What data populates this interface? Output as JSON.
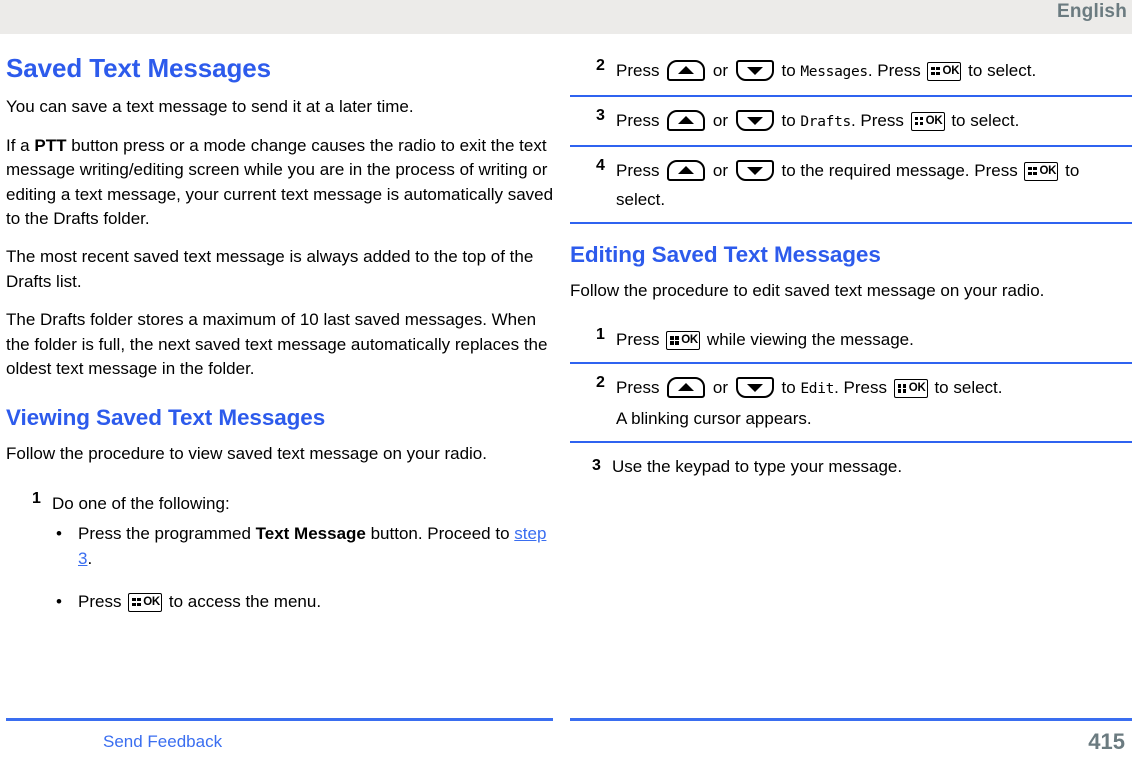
{
  "header": {
    "language": "English"
  },
  "left_column": {
    "section_title": "Saved Text Messages",
    "paragraphs": [
      "You can save a text message to send it at a later time.",
      "If a PTT button press or a mode change causes the radio to exit the text message writing/editing screen while you are in the process of writing or editing a text message, your current text message is automatically saved to the Drafts folder.",
      "The most recent saved text message is always added to the top of the Drafts list.",
      "The Drafts folder stores a maximum of 10 last saved messages. When the folder is full, the next saved text message automatically replaces the oldest text message in the folder."
    ],
    "p2_parts": {
      "before": "If a ",
      "bold": "PTT",
      "after": " button press or a mode change causes the radio to exit the text message writing/editing screen while you are in the process of writing or editing a text message, your current text message is automatically saved to the Drafts folder."
    },
    "subsection_title": "Viewing Saved Text Messages",
    "subsection_intro": "Follow the procedure to view saved text message on your radio.",
    "steps": [
      {
        "num": "1",
        "text": "Do one of the following:",
        "bullets": [
          {
            "marker": "•",
            "before": "Press the programmed ",
            "bold": "Text Message",
            "after": " button. Proceed to ",
            "xref": "step 3",
            "tail": "."
          },
          {
            "marker": "•",
            "before": "Press ",
            "icon": "ok-key-icon",
            "after": " to access the menu."
          }
        ]
      }
    ]
  },
  "right_column": {
    "steps_continued": [
      {
        "num": "2",
        "seg1": "Press ",
        "icon_up": "nav-up-key-icon",
        "seg2": " or ",
        "icon_down": "nav-down-key-icon",
        "seg3": " to ",
        "mono": "Messages",
        "seg4": ". Press ",
        "icon_ok": "ok-key-icon",
        "seg5": " to select."
      },
      {
        "num": "3",
        "seg1": "Press ",
        "icon_up": "nav-up-key-icon",
        "seg2": " or ",
        "icon_down": "nav-down-key-icon",
        "seg3": " to ",
        "mono": "Drafts",
        "seg4": ". Press ",
        "icon_ok": "ok-key-icon",
        "seg5": " to select."
      },
      {
        "num": "4",
        "seg1": "Press ",
        "icon_up": "nav-up-key-icon",
        "seg2": " or ",
        "icon_down": "nav-down-key-icon",
        "seg3": " to the required message. Press ",
        "icon_ok": "ok-key-icon",
        "seg5": " to select."
      }
    ],
    "subsection_title": "Editing Saved Text Messages",
    "subsection_intro": "Follow the procedure to edit saved text message on your radio.",
    "edit_steps": [
      {
        "num": "1",
        "seg1": "Press ",
        "icon_ok": "ok-key-icon",
        "seg5": " while viewing the message."
      },
      {
        "num": "2",
        "seg1": "Press ",
        "icon_up": "nav-up-key-icon",
        "seg2": " or ",
        "icon_down": "nav-down-key-icon",
        "seg3": " to ",
        "mono": "Edit",
        "seg4": ". Press ",
        "icon_ok": "ok-key-icon",
        "seg5": " to select.",
        "note": "A blinking cursor appears."
      },
      {
        "num": "3",
        "seg1": "Use the keypad to type your message."
      }
    ]
  },
  "footer": {
    "send_feedback": "Send Feedback",
    "page_number": "415"
  },
  "icons": {
    "ok_label": "OK"
  },
  "colors": {
    "heading_blue": "#2d5bec",
    "rule_blue": "#2f63f0",
    "link_blue": "#3a6ef0",
    "header_band": "#ecebe9",
    "muted_gray": "#6b7b80"
  }
}
